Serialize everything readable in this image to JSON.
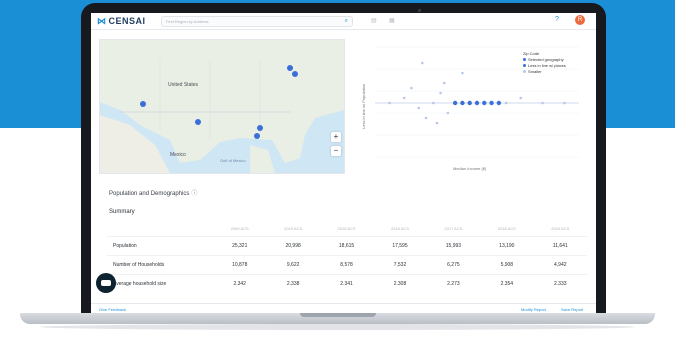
{
  "app": {
    "brand": "CENSAI"
  },
  "search": {
    "placeholder": "Find Region by Address"
  },
  "header": {
    "avatar_initial": "R"
  },
  "map": {
    "labels": {
      "us": "United States",
      "mexico": "Mexico",
      "gulf": "Gulf of Mexico"
    },
    "zoom_in": "+",
    "zoom_out": "−"
  },
  "legend": {
    "title": "Zip Code",
    "items": [
      {
        "label": "Selected geography",
        "color": "#3b6fd8"
      },
      {
        "label": "Less in line w/ places",
        "color": "#3b6fd8"
      },
      {
        "label": "Smaller",
        "color": "#b7c8ea"
      }
    ]
  },
  "chart_data": {
    "type": "scatter",
    "xlabel": "Median Income ($)",
    "ylabel": "Less in line w/ Population",
    "series": [
      {
        "name": "Selected geography",
        "points": [
          [
            110,
            0
          ],
          [
            120,
            0
          ],
          [
            130,
            0
          ],
          [
            140,
            0
          ],
          [
            150,
            0
          ],
          [
            160,
            0
          ],
          [
            170,
            0
          ]
        ]
      },
      {
        "name": "Smaller",
        "points": [
          [
            20,
            0
          ],
          [
            40,
            1
          ],
          [
            60,
            -1
          ],
          [
            80,
            0
          ],
          [
            90,
            2
          ],
          [
            100,
            -2
          ],
          [
            180,
            0
          ],
          [
            200,
            1
          ],
          [
            230,
            0
          ],
          [
            260,
            0
          ],
          [
            50,
            3
          ],
          [
            70,
            -3
          ],
          [
            95,
            4
          ],
          [
            85,
            -4
          ],
          [
            120,
            6
          ],
          [
            65,
            8
          ]
        ]
      }
    ]
  },
  "section": {
    "title": "Population and Demographics",
    "info": "ⓘ"
  },
  "summary": {
    "title": "Summary"
  },
  "table": {
    "columns": [
      "",
      "2000 ACS",
      "2010 ACS",
      "2015 ACS",
      "2016 ACS",
      "2017 ACS",
      "2018 ACS",
      "2019 ACS"
    ],
    "rows": [
      {
        "label": "Population",
        "values": [
          "25,321",
          "20,998",
          "18,615",
          "17,595",
          "15,993",
          "13,190",
          "11,641"
        ]
      },
      {
        "label": "Number of Households",
        "values": [
          "10,878",
          "9,622",
          "8,578",
          "7,532",
          "6,275",
          "5,908",
          "4,942"
        ]
      },
      {
        "label": "Average household size",
        "values": [
          "2.342",
          "2.338",
          "2.341",
          "2.308",
          "2.273",
          "2.354",
          "2.333"
        ]
      }
    ]
  },
  "footer": {
    "feedback": "Give Feedback",
    "modify": "Modify Report",
    "save": "Save Report"
  }
}
